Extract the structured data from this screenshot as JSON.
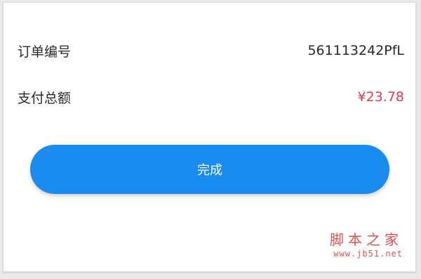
{
  "order": {
    "number_label": "订单编号",
    "number_value": "561113242PfL",
    "total_label": "支付总额",
    "total_value": "¥23.78"
  },
  "actions": {
    "done_label": "完成"
  },
  "watermark": {
    "title": "脚本之家",
    "url": "www.jb51.net"
  },
  "colors": {
    "accent": "#1a8cf0",
    "amount": "#e23a57",
    "watermark": "#e05050"
  }
}
